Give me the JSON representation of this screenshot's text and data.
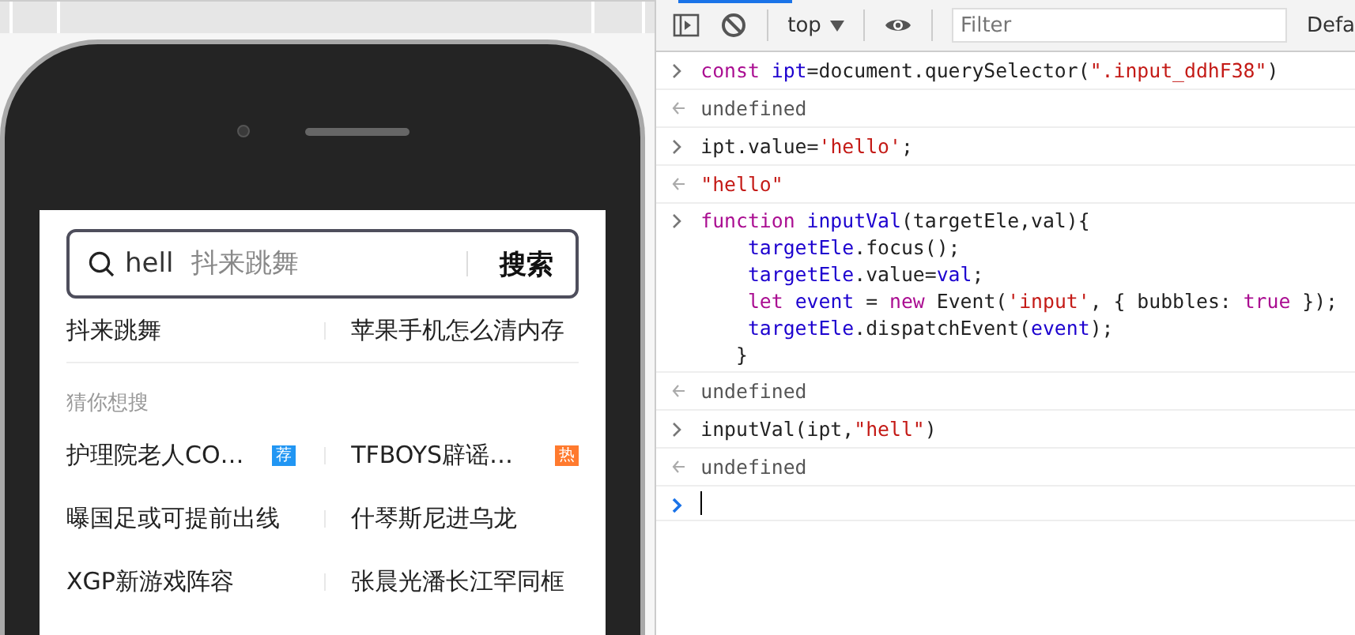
{
  "phone": {
    "search": {
      "value": "hell",
      "placeholder": "抖来跳舞",
      "button": "搜索"
    },
    "history": [
      {
        "text": "抖来跳舞"
      },
      {
        "text": "苹果手机怎么清内存"
      }
    ],
    "section_title": "猜你想搜",
    "suggestions": [
      {
        "text": "护理院老人CO…",
        "badge": "荐",
        "color": "#2196f3"
      },
      {
        "text": "TFBOYS辟谣…",
        "badge": "热",
        "color": "#ff7a2e"
      },
      {
        "text": "曝国足或可提前出线"
      },
      {
        "text": "什琴斯尼进乌龙"
      },
      {
        "text": "XGP新游戏阵容"
      },
      {
        "text": "张晨光潘长江罕同框"
      }
    ]
  },
  "devtools": {
    "context": "top",
    "filter_placeholder": "Filter",
    "levels": "Defa",
    "entries": [
      {
        "kind": "input",
        "lines": [
          [
            {
              "text": "const ",
              "color": "#aa0d91"
            },
            {
              "text": "ipt",
              "color": "#1c00cf"
            },
            {
              "text": "=document.querySelector(",
              "color": "#222222"
            },
            {
              "text": "\".input_ddhF38\"",
              "color": "#c41a16"
            },
            {
              "text": ")",
              "color": "#222222"
            }
          ]
        ]
      },
      {
        "kind": "output",
        "lines": [
          [
            {
              "text": "undefined",
              "color": "#555555"
            }
          ]
        ]
      },
      {
        "kind": "input",
        "lines": [
          [
            {
              "text": "ipt.value=",
              "color": "#222222"
            },
            {
              "text": "'hello'",
              "color": "#c41a16"
            },
            {
              "text": ";",
              "color": "#222222"
            }
          ]
        ]
      },
      {
        "kind": "output",
        "lines": [
          [
            {
              "text": "\"hello\"",
              "color": "#c41a16"
            }
          ]
        ]
      },
      {
        "kind": "input",
        "lines": [
          [
            {
              "text": "function ",
              "color": "#aa0d91"
            },
            {
              "text": "inputVal",
              "color": "#1c00cf"
            },
            {
              "text": "(targetEle,val){",
              "color": "#222222"
            }
          ],
          [
            {
              "text": "    targetEle",
              "color": "#1c00cf"
            },
            {
              "text": ".focus();",
              "color": "#222222"
            }
          ],
          [
            {
              "text": "    targetEle",
              "color": "#1c00cf"
            },
            {
              "text": ".value=",
              "color": "#222222"
            },
            {
              "text": "val",
              "color": "#1c00cf"
            },
            {
              "text": ";",
              "color": "#222222"
            }
          ],
          [
            {
              "text": "    let ",
              "color": "#aa0d91"
            },
            {
              "text": "event",
              "color": "#1c00cf"
            },
            {
              "text": " = ",
              "color": "#222222"
            },
            {
              "text": "new ",
              "color": "#aa0d91"
            },
            {
              "text": "Event(",
              "color": "#222222"
            },
            {
              "text": "'input'",
              "color": "#c41a16"
            },
            {
              "text": ", { bubbles: ",
              "color": "#222222"
            },
            {
              "text": "true",
              "color": "#aa0d91"
            },
            {
              "text": " });",
              "color": "#222222"
            }
          ],
          [
            {
              "text": "    targetEle",
              "color": "#1c00cf"
            },
            {
              "text": ".dispatchEvent(",
              "color": "#222222"
            },
            {
              "text": "event",
              "color": "#1c00cf"
            },
            {
              "text": ");",
              "color": "#222222"
            }
          ],
          [
            {
              "text": "   }",
              "color": "#222222"
            }
          ]
        ]
      },
      {
        "kind": "output",
        "lines": [
          [
            {
              "text": "undefined",
              "color": "#555555"
            }
          ]
        ]
      },
      {
        "kind": "input",
        "lines": [
          [
            {
              "text": "inputVal(ipt,",
              "color": "#222222"
            },
            {
              "text": "\"hell\"",
              "color": "#c41a16"
            },
            {
              "text": ")",
              "color": "#222222"
            }
          ]
        ]
      },
      {
        "kind": "output",
        "lines": [
          [
            {
              "text": "undefined",
              "color": "#555555"
            }
          ]
        ]
      },
      {
        "kind": "prompt"
      }
    ]
  }
}
